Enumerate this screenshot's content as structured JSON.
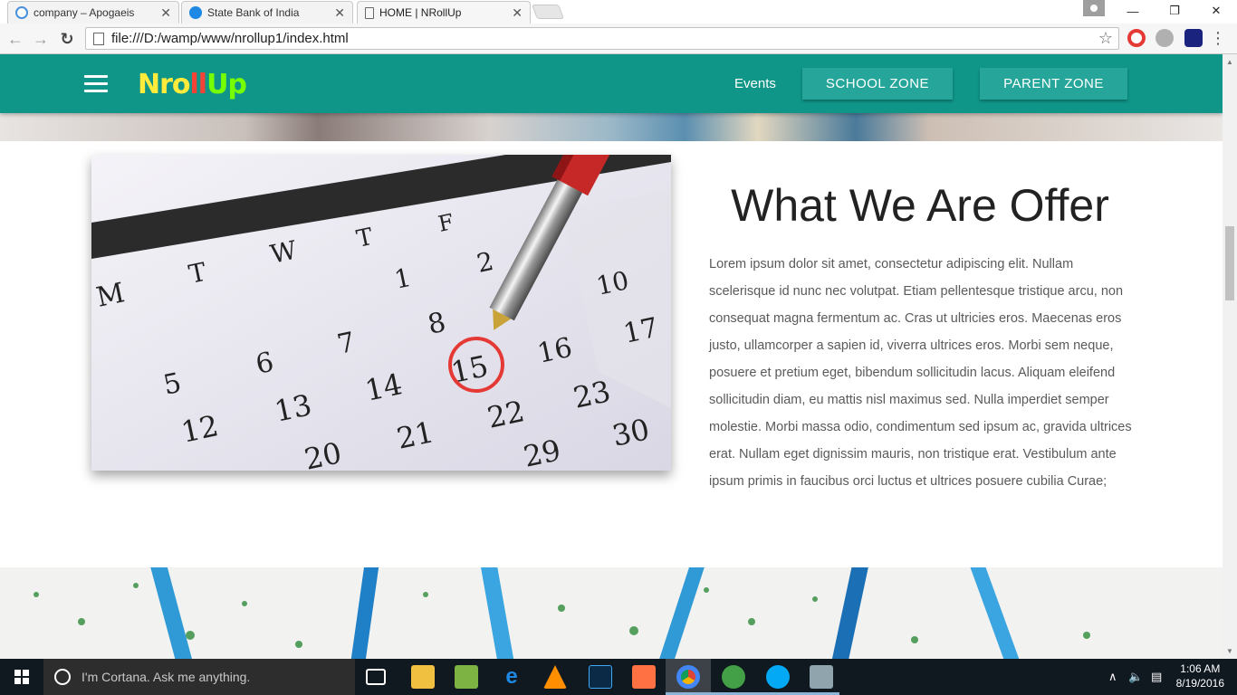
{
  "browser": {
    "tabs": [
      {
        "title": "company – Apogaeis",
        "favicon_color": "#4a90d9"
      },
      {
        "title": "State Bank of India",
        "favicon_color": "#1e88e5"
      },
      {
        "title": "HOME | NRollUp",
        "favicon_color": "#ffffff"
      }
    ],
    "url": "file:///D:/wamp/www/nrollup1/index.html"
  },
  "site": {
    "logo": {
      "part1": "N",
      "part2": "ro",
      "part3": "ll",
      "part4": "Up"
    },
    "nav": {
      "events": "Events",
      "school_zone": "SCHOOL ZONE",
      "parent_zone": "PARENT ZONE"
    },
    "header_color": "#0f9688",
    "button_color": "#26a69a"
  },
  "offer": {
    "title": "What We Are Offer",
    "body": "Lorem ipsum dolor sit amet, consectetur adipiscing elit. Nullam scelerisque id nunc nec volutpat. Etiam pellentesque tristique arcu, non consequat magna fermentum ac. Cras ut ultricies eros. Maecenas eros justo, ullamcorper a sapien id, viverra ultrices eros. Morbi sem neque, posuere et pretium eget, bibendum sollicitudin lacus. Aliquam eleifend sollicitudin diam, eu mattis nisl maximus sed. Nulla imperdiet semper molestie. Morbi massa odio, condimentum sed ipsum ac, gravida ultrices erat. Nullam eget dignissim mauris, non tristique erat. Vestibulum ante ipsum primis in faucibus orci luctus et ultrices posuere cubilia Curae;",
    "calendar_days": [
      "M",
      "T",
      "W",
      "T",
      "F"
    ],
    "calendar_numbers": [
      "1",
      "2",
      "5",
      "6",
      "7",
      "8",
      "12",
      "13",
      "14",
      "15",
      "16",
      "17",
      "20",
      "21",
      "22",
      "23",
      "29",
      "30",
      "10"
    ]
  },
  "taskbar": {
    "search_placeholder": "I'm Cortana. Ask me anything.",
    "time": "1:06 AM",
    "date": "8/19/2016"
  }
}
